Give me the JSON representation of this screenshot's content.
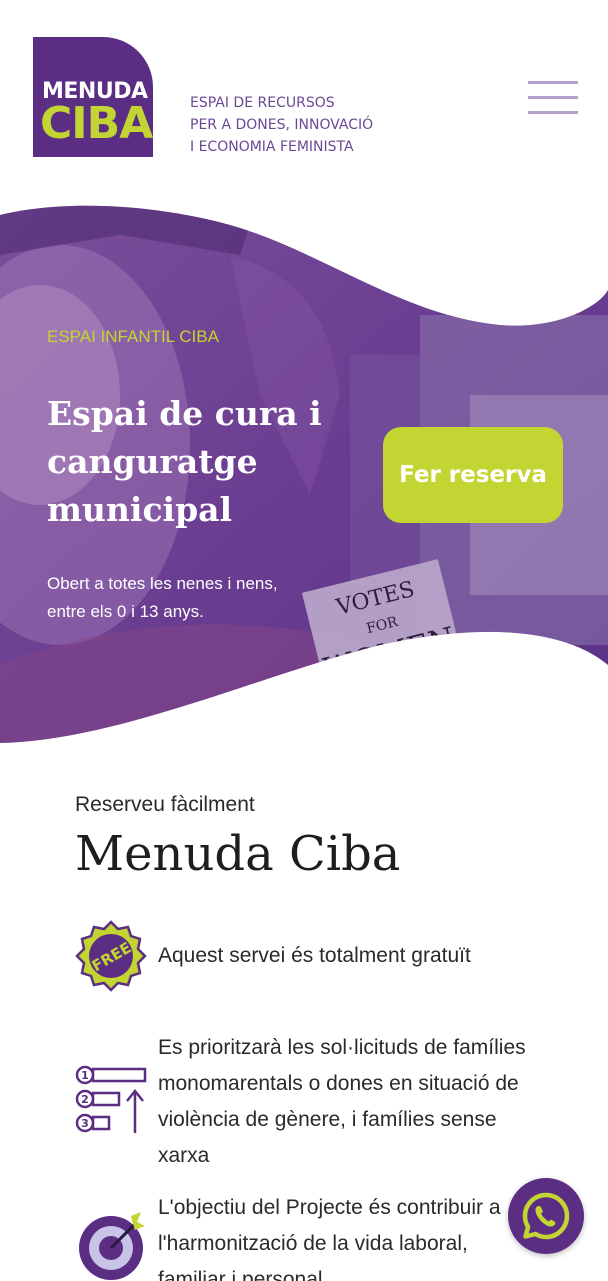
{
  "header": {
    "logo_line1": "MENUDA",
    "logo_line2": "CIBA",
    "tagline": [
      "ESPAI DE RECURSOS",
      "PER A DONES, INNOVACIÓ",
      "I ECONOMIA FEMINISTA"
    ],
    "menu_icon": "hamburger-icon"
  },
  "hero": {
    "eyebrow": "ESPAI INFANTIL CIBA",
    "title": [
      "Espai de cura i",
      "canguratge",
      "municipal"
    ],
    "description": [
      "Obert a totes les nenes i nens,",
      "entre els 0 i 13 anys."
    ],
    "reserve_label": "Fer reserva",
    "sign_text": [
      "VOTES",
      "FOR",
      "WOMEN"
    ]
  },
  "section": {
    "subtitle": "Reserveu fàcilment",
    "title": "Menuda Ciba"
  },
  "features": [
    {
      "icon": "free-badge-icon",
      "badge_text": "FREE",
      "lines": [
        "Aquest servei és totalment gratuït"
      ]
    },
    {
      "icon": "priority-list-icon",
      "numbers": [
        "1",
        "2",
        "3"
      ],
      "lines": [
        "Es prioritzarà les sol·licituds de famílies",
        "monomarentals o dones en situació de",
        "violència de gènere, i famílies sense",
        "xarxa"
      ]
    },
    {
      "icon": "target-icon",
      "lines": [
        "L'objectiu del Projecte és contribuir a",
        "l'harmonització de la vida laboral,",
        "familiar i personal"
      ]
    }
  ],
  "floating": {
    "icon": "whatsapp-icon"
  },
  "colors": {
    "brand_purple": "#5b2e83",
    "accent_lime": "#c3d532",
    "tagline_purple": "#6a4a93"
  }
}
